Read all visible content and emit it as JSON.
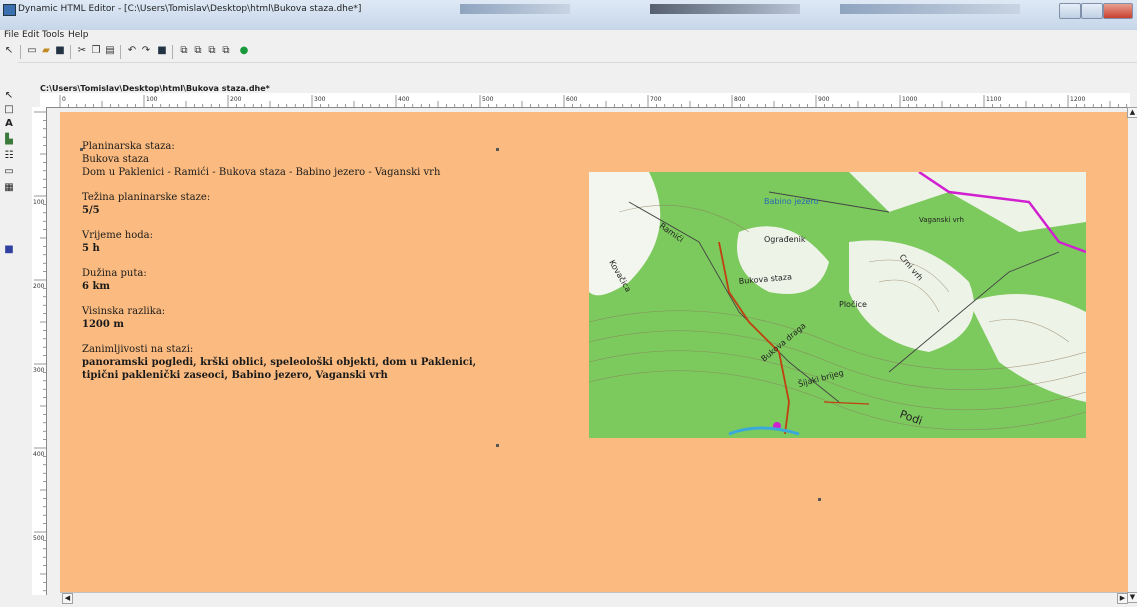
{
  "window": {
    "title": "Dynamic HTML Editor - [C:\\Users\\Tomislav\\Desktop\\html\\Bukova staza.dhe*]"
  },
  "menu": [
    "File",
    "Edit",
    "Tools",
    "Help"
  ],
  "document": {
    "tab_path": "C:\\Users\\Tomislav\\Desktop\\html\\Bukova staza.dhe*"
  },
  "ruler": {
    "h_ticks": [
      "0",
      "100",
      "200",
      "300",
      "400",
      "500",
      "600",
      "700",
      "800",
      "900",
      "1000",
      "1100",
      "1200"
    ],
    "v_ticks": [
      "100",
      "200",
      "300",
      "400",
      "500"
    ]
  },
  "page": {
    "background": "#fbbb80",
    "trail_label": "Planinarska staza:",
    "trail_name": "Bukova staza",
    "trail_route": "Dom u Paklenici - Ramići - Bukova staza - Babino jezero - Vaganski vrh",
    "difficulty_label": "Težina planinarske staze:",
    "difficulty_value": "5/5",
    "time_label": "Vrijeme hoda:",
    "time_value": "5 h",
    "length_label": "Dužina puta:",
    "length_value": "6 km",
    "elevation_label": "Visinska razlika:",
    "elevation_value": "1200 m",
    "sights_label": "Zanimljivosti na stazi:",
    "sights_value": "panoramski pogledi, krški oblici, speleološki objekti, dom u Paklenici, tipični paklenički zaseoci, Babino jezero, Vaganski vrh"
  },
  "map": {
    "labels": [
      "Babino jezero",
      "Bukova staza",
      "Kovačica",
      "Ramići",
      "Bukova draga",
      "Pločice",
      "Ograđenik",
      "Šijaki brijeg",
      "Crni vrh",
      "Vaganski vrh",
      "Podi"
    ],
    "colors": {
      "forest": "#7cc95e",
      "open": "#eef3e8",
      "route": "#c04010",
      "border": "#d020d0"
    }
  }
}
